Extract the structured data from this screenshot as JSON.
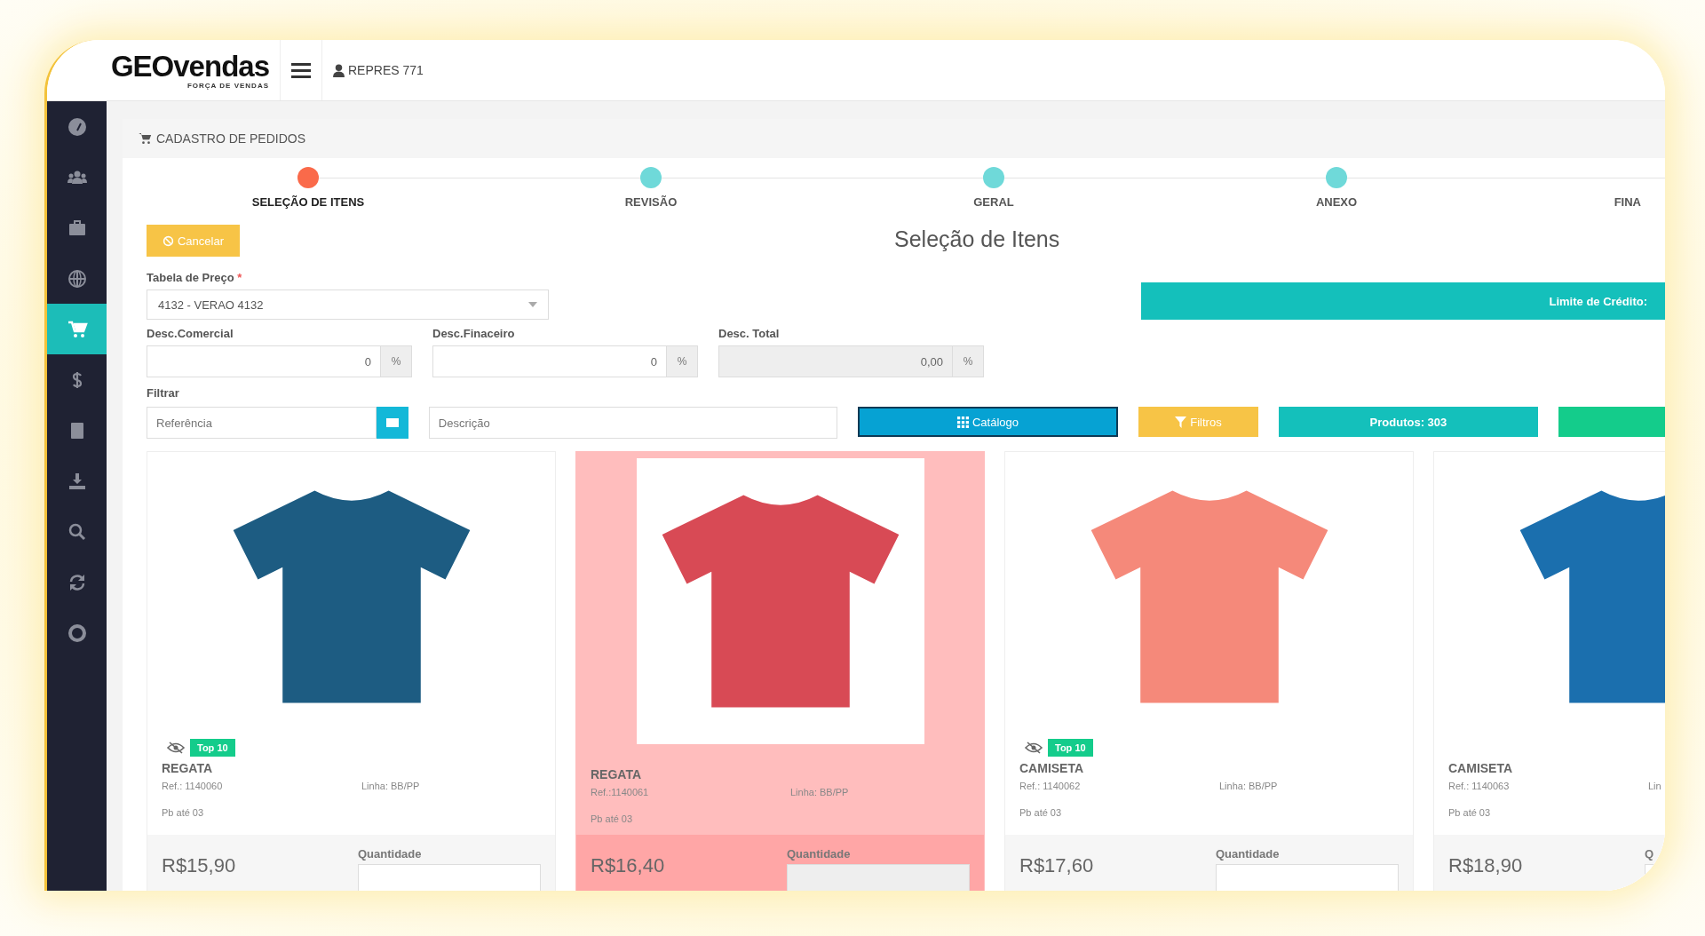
{
  "header": {
    "logo": "GEOvendas",
    "logo_tagline": "FORÇA DE VENDAS",
    "user": "REPRES 771"
  },
  "sidebar": {
    "items": [
      {
        "selected": false
      },
      {
        "selected": false
      },
      {
        "selected": false
      },
      {
        "selected": false
      },
      {
        "selected": true
      },
      {
        "selected": false
      },
      {
        "selected": false
      },
      {
        "selected": false
      },
      {
        "selected": false
      },
      {
        "selected": false
      },
      {
        "selected": false
      }
    ]
  },
  "breadcrumb": "CADASTRO DE PEDIDOS",
  "steps": [
    {
      "label": "SELEÇÃO DE ITENS",
      "selected": true,
      "dot_visible": true
    },
    {
      "label": "REVISÃO",
      "selected": false,
      "dot_visible": true
    },
    {
      "label": "GERAL",
      "selected": false,
      "dot_visible": true
    },
    {
      "label": "ANEXO",
      "selected": false,
      "dot_visible": true
    },
    {
      "label": "FINA",
      "selected": false,
      "dot_visible": false
    }
  ],
  "cancel_button": "Cancelar",
  "title": "Seleção de Itens",
  "price_table": {
    "label": "Tabela de Preço",
    "required_mark": "*",
    "value": "4132 - VERAO 4132"
  },
  "credit_limit": "Limite de Crédito:",
  "discounts": [
    {
      "label": "Desc.Comercial",
      "value": "0",
      "unit": "%",
      "disabled": false
    },
    {
      "label": "Desc.Finaceiro",
      "value": "0",
      "unit": "%",
      "disabled": false
    },
    {
      "label": "Desc. Total",
      "value": "0,00",
      "unit": "%",
      "disabled": true
    }
  ],
  "filter": {
    "label": "Filtrar",
    "reference_placeholder": "Referência",
    "description_placeholder": "Descrição",
    "catalog_button": "Catálogo",
    "filters_button": "Filtros",
    "products_button": "Produtos: 303"
  },
  "products": [
    {
      "name": "REGATA",
      "ref": "Ref.: 1140060",
      "line": "Linha: BB/PP",
      "pb": "Pb até 03",
      "price": "R$15,90",
      "qty_label": "Quantidade",
      "badge": "Top 10",
      "selected": false,
      "color": "#1d5c82"
    },
    {
      "name": "REGATA",
      "ref": "Ref.:1140061",
      "line": "Linha: BB/PP",
      "pb": "Pb até 03",
      "price": "R$16,40",
      "qty_label": "Quantidade",
      "selected": true,
      "color": "#d84a55"
    },
    {
      "name": "CAMISETA",
      "ref": "Ref.: 1140062",
      "line": "Linha: BB/PP",
      "pb": "Pb até 03",
      "price": "R$17,60",
      "qty_label": "Quantidade",
      "badge": "Top 10",
      "selected": false,
      "color": "#f5897a"
    },
    {
      "name": "CAMISETA",
      "ref": "Ref.: 1140063",
      "line": "Lin",
      "pb": "Pb até 03",
      "price": "R$18,90",
      "qty_label": "Q",
      "selected": false,
      "color": "#1b6fae"
    }
  ]
}
